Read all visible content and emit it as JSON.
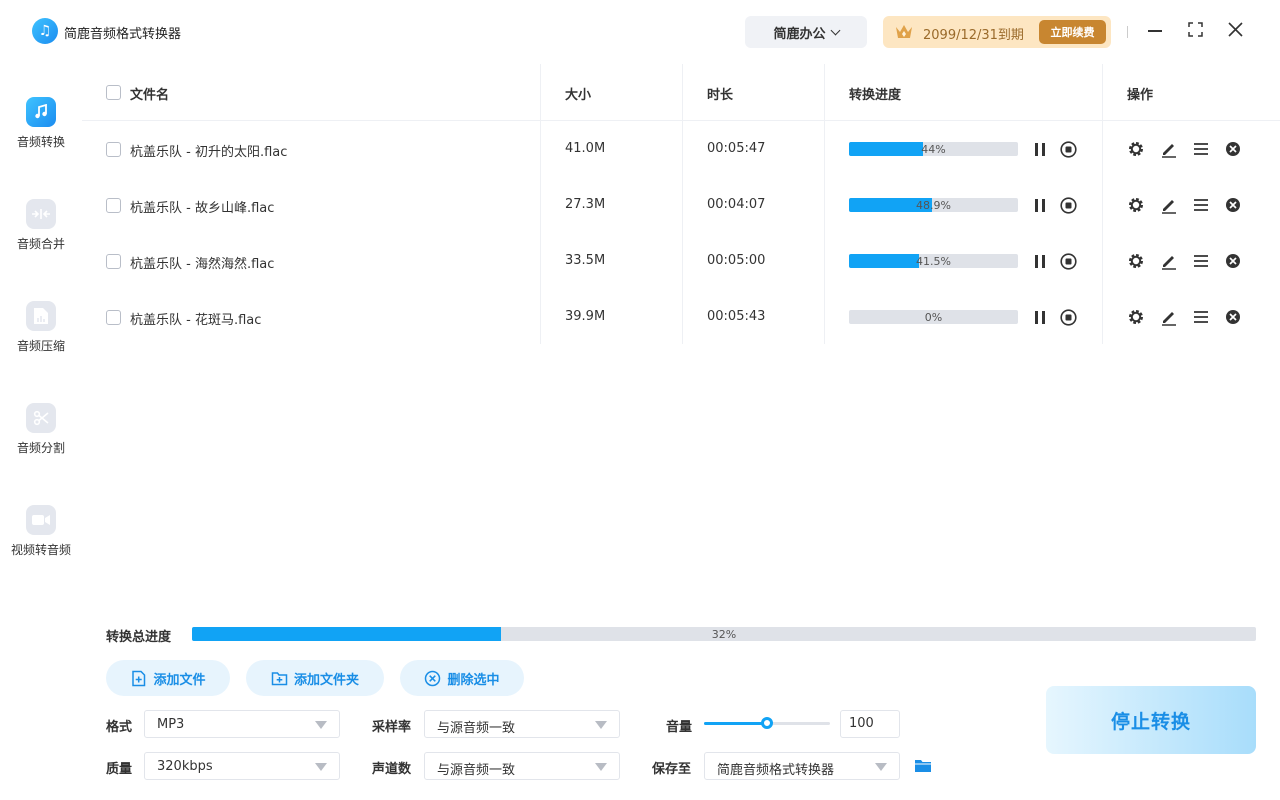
{
  "app": {
    "title": "简鹿音频格式转换器",
    "office_label": "简鹿办公",
    "vip_expire": "2099/12/31到期",
    "renew_label": "立即续费"
  },
  "sidebar": {
    "items": [
      {
        "label": "音频转换",
        "icon": "music-note-icon",
        "active": true
      },
      {
        "label": "音频合并",
        "icon": "merge-icon",
        "active": false
      },
      {
        "label": "音频压缩",
        "icon": "compress-icon",
        "active": false
      },
      {
        "label": "音频分割",
        "icon": "scissors-icon",
        "active": false
      },
      {
        "label": "视频转音频",
        "icon": "video-camera-icon",
        "active": false
      }
    ]
  },
  "table": {
    "headers": {
      "name": "文件名",
      "size": "大小",
      "duration": "时长",
      "progress": "转换进度",
      "actions": "操作"
    },
    "rows": [
      {
        "name": "杭盖乐队 - 初升的太阳.flac",
        "size": "41.0M",
        "duration": "00:05:47",
        "progress_text": "44%",
        "progress": 0.44
      },
      {
        "name": "杭盖乐队 - 故乡山峰.flac",
        "size": "27.3M",
        "duration": "00:04:07",
        "progress_text": "48.9%",
        "progress": 0.489
      },
      {
        "name": "杭盖乐队 - 海然海然.flac",
        "size": "33.5M",
        "duration": "00:05:00",
        "progress_text": "41.5%",
        "progress": 0.415
      },
      {
        "name": "杭盖乐队 - 花斑马.flac",
        "size": "39.9M",
        "duration": "00:05:43",
        "progress_text": "0%",
        "progress": 0
      }
    ]
  },
  "bottom": {
    "total_label": "转换总进度",
    "total_progress_text": "32%",
    "total_progress": 0.29,
    "add_file_label": "添加文件",
    "add_folder_label": "添加文件夹",
    "delete_selected_label": "删除选中",
    "format_label": "格式",
    "format_value": "MP3",
    "quality_label": "质量",
    "quality_value": "320kbps",
    "samplerate_label": "采样率",
    "samplerate_value": "与源音频一致",
    "channels_label": "声道数",
    "channels_value": "与源音频一致",
    "volume_label": "音量",
    "volume_value": "100",
    "volume_level": 0.5,
    "saveto_label": "保存至",
    "saveto_value": "简鹿音频格式转换器",
    "stop_label": "停止转换"
  },
  "colors": {
    "accent": "#11a3f5",
    "vip_bg": "#fde6c2",
    "renew_bg": "#c88630"
  }
}
